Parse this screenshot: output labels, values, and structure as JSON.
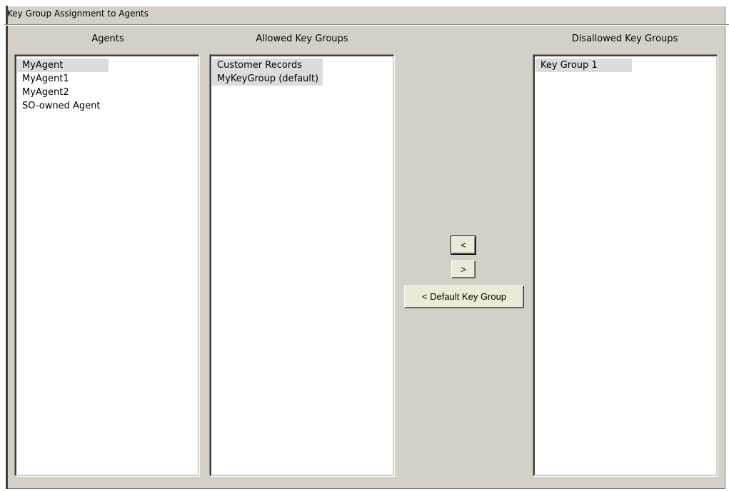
{
  "dialog": {
    "title": "Key Group Assignment to Agents"
  },
  "columns": {
    "agents": {
      "header": "Agents",
      "items": [
        {
          "label": "MyAgent",
          "selected": true
        },
        {
          "label": "MyAgent1",
          "selected": false
        },
        {
          "label": "MyAgent2",
          "selected": false
        },
        {
          "label": "SO-owned Agent",
          "selected": false
        }
      ]
    },
    "allowed": {
      "header": "Allowed Key Groups",
      "items": [
        {
          "label": "Customer Records",
          "selected": true
        },
        {
          "label": "MyKeyGroup (default)",
          "selected": true
        }
      ]
    },
    "disallowed": {
      "header": "Disallowed Key Groups",
      "items": [
        {
          "label": "Key Group 1",
          "selected": true
        }
      ]
    }
  },
  "buttons": {
    "move_left": "<",
    "move_right": ">",
    "default_key_group": "< Default Key Group"
  }
}
